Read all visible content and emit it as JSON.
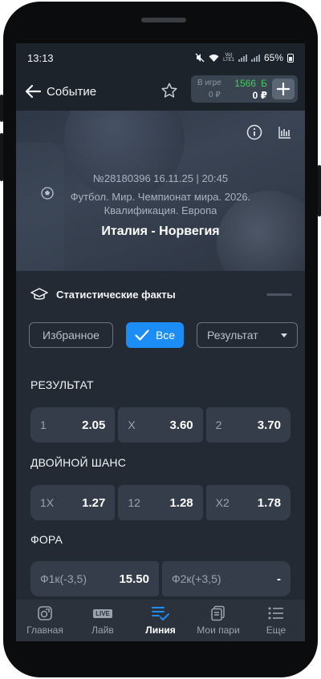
{
  "status_bar": {
    "time": "13:13",
    "network_badge_top": "Vo)",
    "network_badge_bottom": "LTE1",
    "battery": "65%"
  },
  "header": {
    "back_icon": "arrow-left-icon",
    "title": "Событие",
    "favorite_icon": "star-icon",
    "balance": {
      "in_game_label": "В игре",
      "in_game_value": "0 ₽",
      "bonus_value": "1566",
      "bonus_currency": "Б",
      "main_value": "0 ₽",
      "add_icon": "plus-icon"
    }
  },
  "event": {
    "info_icon": "info-icon",
    "stats_icon": "bar-chart-icon",
    "id_datetime": "№28180396 16.11.25 | 20:45",
    "sport_icon": "soccer-ball-icon",
    "tournament_line1": "Футбол. Мир. Чемпионат мира. 2026.",
    "tournament_line2": "Квалификация. Европа",
    "teams": "Италия - Норвегия"
  },
  "stats_facts": {
    "icon": "graduation-cap-icon",
    "label": "Статистические факты"
  },
  "filters": {
    "favorites": "Избранное",
    "all": "Все",
    "result": "Результат"
  },
  "markets": [
    {
      "title": "РЕЗУЛЬТАТ",
      "outcomes": [
        {
          "label": "1",
          "odds": "2.05"
        },
        {
          "label": "X",
          "odds": "3.60"
        },
        {
          "label": "2",
          "odds": "3.70"
        }
      ]
    },
    {
      "title": "ДВОЙНОЙ ШАНС",
      "outcomes": [
        {
          "label": "1X",
          "odds": "1.27"
        },
        {
          "label": "12",
          "odds": "1.28"
        },
        {
          "label": "X2",
          "odds": "1.78"
        }
      ]
    },
    {
      "title": "ФОРА",
      "outcomes": [
        {
          "label": "Ф1к(-3,5)",
          "odds": "15.50"
        },
        {
          "label": "Ф2к(+3,5)",
          "odds": "-"
        }
      ]
    }
  ],
  "bottom_nav": [
    {
      "label": "Главная",
      "icon": "home-icon"
    },
    {
      "label": "Лайв",
      "icon": "live-icon",
      "badge": "LIVE"
    },
    {
      "label": "Линия",
      "icon": "list-check-icon",
      "active": true
    },
    {
      "label": "Мои пари",
      "icon": "tickets-icon"
    },
    {
      "label": "Еще",
      "icon": "menu-icon"
    }
  ],
  "colors": {
    "accent": "#1b8df5",
    "bonus": "#3ecf5a",
    "background": "#232a33",
    "card": "#343d49"
  }
}
